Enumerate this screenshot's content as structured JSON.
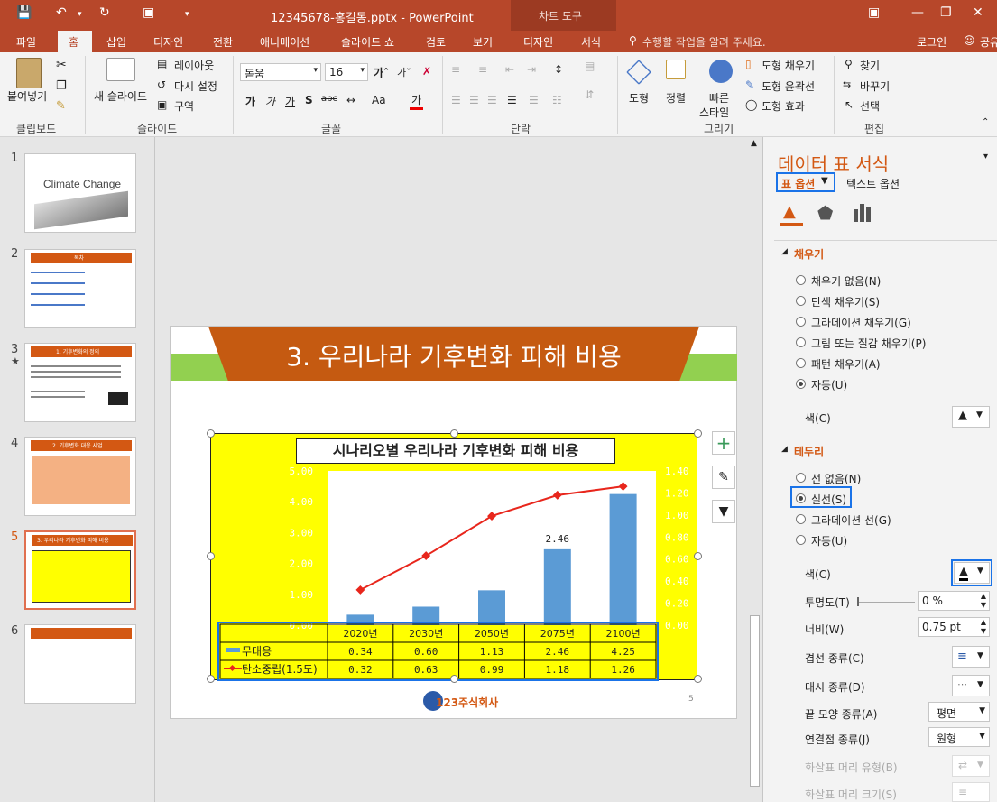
{
  "titlebar": {
    "title": "12345678-홍길동.pptx - PowerPoint",
    "context_tool": "차트 도구"
  },
  "tabs": [
    {
      "label": "파일"
    },
    {
      "label": "홈"
    },
    {
      "label": "삽입"
    },
    {
      "label": "디자인"
    },
    {
      "label": "전환"
    },
    {
      "label": "애니메이션"
    },
    {
      "label": "슬라이드 쇼"
    },
    {
      "label": "검토"
    },
    {
      "label": "보기"
    },
    {
      "label": "디자인"
    },
    {
      "label": "서식"
    }
  ],
  "tell_me": "수행할 작업을 알려 주세요.",
  "login": "로그인",
  "share": "공유",
  "ribbon": {
    "paste": "붙여넣기",
    "new_slide": "새 슬라이드",
    "layout": "레이아웃",
    "reset": "다시 설정",
    "section": "구역",
    "font_name": "돋움",
    "font_size": "16",
    "shape": "도형",
    "arrange": "정렬",
    "quick_style_1": "빠른",
    "quick_style_2": "스타일",
    "shape_fill": "도형 채우기",
    "shape_outline": "도형 윤곽선",
    "shape_effects": "도형 효과",
    "find": "찾기",
    "replace": "바꾸기",
    "select": "선택",
    "groups": {
      "clipboard": "클립보드",
      "slides": "슬라이드",
      "font": "글꼴",
      "paragraph": "단락",
      "drawing": "그리기",
      "editing": "편집"
    }
  },
  "thumbnails": [
    {
      "num": "1",
      "title": "Climate Change"
    },
    {
      "num": "2",
      "title": "목차"
    },
    {
      "num": "3",
      "title": "1. 기후변화의 정의"
    },
    {
      "num": "4",
      "title": "2. 기후변화 대응 사업"
    },
    {
      "num": "5",
      "title": "3. 우리나라 기후변화 피해 비용"
    },
    {
      "num": "6",
      "title": ""
    }
  ],
  "slide": {
    "title": "3. 우리나라 기후변화 피해 비용",
    "page_num": "5",
    "logo_text": "123주식회사"
  },
  "chart_data": {
    "type": "bar",
    "title": "시나리오별 우리나라 기후변화 피해 비용",
    "categories": [
      "2020년",
      "2030년",
      "2050년",
      "2075년",
      "2100년"
    ],
    "series": [
      {
        "name": "무대응",
        "type": "bar",
        "values": [
          0.34,
          0.6,
          1.13,
          2.46,
          4.25
        ],
        "color": "#5b9bd5"
      },
      {
        "name": "탄소중립(1.5도)",
        "type": "line",
        "values": [
          0.32,
          0.63,
          0.99,
          1.18,
          1.26
        ],
        "color": "#e8261c"
      }
    ],
    "y_left": {
      "ticks": [
        "0.00",
        "1.00",
        "2.00",
        "3.00",
        "4.00",
        "5.00"
      ],
      "range": [
        0,
        5
      ]
    },
    "y_right": {
      "ticks": [
        "0.00",
        "0.20",
        "0.40",
        "0.60",
        "0.80",
        "1.00",
        "1.20",
        "1.40"
      ],
      "range": [
        0,
        1.4
      ]
    },
    "data_label": "2.46",
    "table_rows": [
      {
        "name": "무대응",
        "values": [
          "0.34",
          "0.60",
          "1.13",
          "2.46",
          "4.25"
        ]
      },
      {
        "name": "탄소중립(1.5도)",
        "values": [
          "0.32",
          "0.63",
          "0.99",
          "1.18",
          "1.26"
        ]
      }
    ],
    "background": "#ffff00"
  },
  "pane": {
    "title": "데이터 표 서식",
    "tab_options": "표 옵션",
    "tab_text": "텍스트 옵션",
    "fill_section": "채우기",
    "fill_options": [
      "채우기 없음(N)",
      "단색 채우기(S)",
      "그라데이션 채우기(G)",
      "그림 또는 질감 채우기(P)",
      "패턴 채우기(A)",
      "자동(U)"
    ],
    "color_label": "색(C)",
    "border_section": "테두리",
    "border_options": [
      "선 없음(N)",
      "실선(S)",
      "그라데이션 선(G)",
      "자동(U)"
    ],
    "border_color_label": "색(C)",
    "transparency_label": "투명도(T)",
    "transparency_value": "0 %",
    "width_label": "너비(W)",
    "width_value": "0.75 pt",
    "compound_label": "겹선 종류(C)",
    "dash_label": "대시 종류(D)",
    "cap_label": "끝 모양 종류(A)",
    "cap_value": "평면",
    "join_label": "연결점 종류(J)",
    "join_value": "원형",
    "arrow_begin_label": "화살표 머리 유형(B)",
    "arrow_size_label": "화살표 머리 크기(S)"
  },
  "colors": {
    "accent": "#b7472a",
    "slide_title_bg": "#c55a11",
    "slide_green": "#92d050",
    "highlight": "#1a73e8"
  }
}
